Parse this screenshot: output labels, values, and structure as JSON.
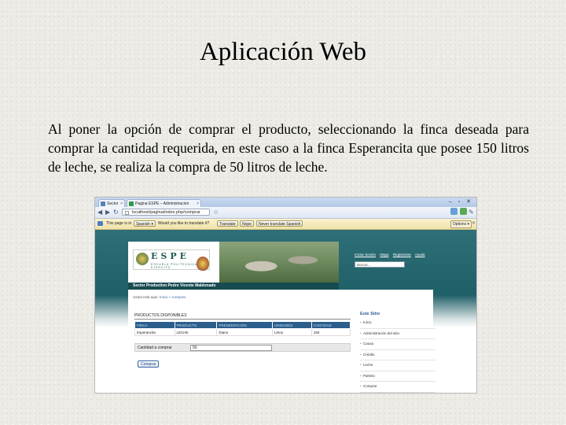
{
  "slide": {
    "title": "Aplicación Web",
    "body": "Al poner la opción de comprar el producto, seleccionando la finca deseada para comprar la cantidad requerida, en este caso a la finca Esperancita que posee 150 litros de leche, se realiza la compra de 50 litros de leche."
  },
  "browser": {
    "tabs": [
      {
        "label": "Sector"
      },
      {
        "label": "Pagina ESPE – Administracion"
      }
    ],
    "window_buttons": "– ▫ ✕",
    "url": "localhost/pagina/index.php/comprar",
    "translate_bar": {
      "message": "This page is in",
      "language": "Spanish ▾",
      "question": "Would you like to translate it?",
      "translate_btn": "Translate",
      "nope_btn": "Nope",
      "never_btn": "Never translate Spanish",
      "options_btn": "Options ▾",
      "close": "✕"
    }
  },
  "site": {
    "logo_text": "ESPE",
    "logo_sub": "ESCUELA POLITECNICA DEL EJERCITO",
    "title": "Sector Productivo Pedro Vicente Maldonado",
    "top_links": [
      "Iniciar Sesión",
      "Mapa",
      "Registrarse",
      "Ayuda"
    ],
    "search_placeholder": "Buscar...",
    "breadcrumb": {
      "prefix": "Usted está aquí:",
      "link1": "Inicio",
      "link2": "Comprar"
    }
  },
  "products": {
    "heading": "Productos Disponibles",
    "columns": [
      "FINCA",
      "PRODUCTO",
      "PRESENTACION",
      "UNIDADES",
      "CANTIDAD"
    ],
    "rows": [
      [
        "Esperancita",
        "LECHE",
        "Diario",
        "Litros",
        "150"
      ]
    ],
    "qty_label": "Cantidad a comprar",
    "qty_value": "50",
    "buy_button": "Comprar"
  },
  "sidebar": {
    "title": "Este Sitio",
    "items": [
      "Inicio",
      "Administración del sitio",
      "Causa",
      "Crédito",
      "Leche",
      "Palmito",
      "Comprar"
    ]
  }
}
